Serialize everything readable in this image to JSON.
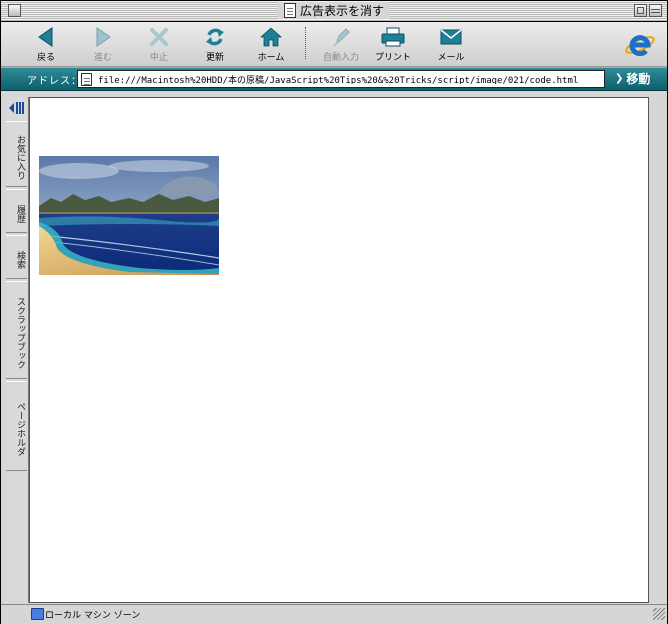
{
  "window": {
    "title": "広告表示を消す"
  },
  "toolbar": {
    "buttons": [
      {
        "label": "戻る",
        "icon": "back-arrow-icon",
        "enabled": true
      },
      {
        "label": "進む",
        "icon": "forward-arrow-icon",
        "enabled": false
      },
      {
        "label": "中止",
        "icon": "stop-x-icon",
        "enabled": false
      },
      {
        "label": "更新",
        "icon": "refresh-icon",
        "enabled": true
      },
      {
        "label": "ホーム",
        "icon": "home-icon",
        "enabled": true
      },
      {
        "label": "自動入力",
        "icon": "autofill-pen-icon",
        "enabled": false
      },
      {
        "label": "プリント",
        "icon": "printer-icon",
        "enabled": true
      },
      {
        "label": "メール",
        "icon": "mail-envelope-icon",
        "enabled": true
      }
    ],
    "brand_icon": "internet-explorer-logo"
  },
  "address": {
    "label": "アドレス：",
    "value": "file:///Macintosh%20HDD/本の原稿/JavaScript%20Tips%20&%20Tricks/script/image/021/code.html",
    "go_label": "移動"
  },
  "sidebar": {
    "tabs": [
      "お気に入り",
      "履歴",
      "検索",
      "スクラップブック",
      "ページホルダ"
    ]
  },
  "content": {
    "image": "beach-landscape-with-moon"
  },
  "status": {
    "zone": "ローカル マシン ゾーン"
  },
  "colors": {
    "toolbar_icon_teal": "#1f7f96",
    "address_bar": "#1a6f7a",
    "window_bg": "#d6d6d6"
  }
}
